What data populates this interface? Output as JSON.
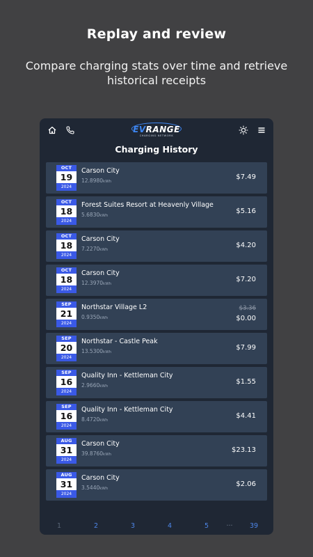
{
  "promo": {
    "title": "Replay and review",
    "subtitle": "Compare charging stats over time and retrieve historical receipts"
  },
  "app": {
    "logo": {
      "ev": "EV",
      "range": "RANGE",
      "tagline": "CHARGING NETWORK"
    },
    "title": "Charging History",
    "icons": [
      "home-icon",
      "phone-icon",
      "theme-sun-icon",
      "menu-icon"
    ],
    "colors": {
      "accent": "#3a59e6",
      "link": "#4d86e8",
      "card": "#324155",
      "background": "#1f2734"
    }
  },
  "sessions": [
    {
      "month": "OCT",
      "day": "19",
      "year": "2024",
      "site": "Carson City",
      "energy": "12.8980",
      "unit": "kWh",
      "price": "$7.49",
      "old_price": ""
    },
    {
      "month": "OCT",
      "day": "18",
      "year": "2024",
      "site": "Forest Suites Resort at Heavenly Village",
      "energy": "5.6830",
      "unit": "kWh",
      "price": "$5.16",
      "old_price": ""
    },
    {
      "month": "OCT",
      "day": "18",
      "year": "2024",
      "site": "Carson City",
      "energy": "7.2270",
      "unit": "kWh",
      "price": "$4.20",
      "old_price": ""
    },
    {
      "month": "OCT",
      "day": "18",
      "year": "2024",
      "site": "Carson City",
      "energy": "12.3970",
      "unit": "kWh",
      "price": "$7.20",
      "old_price": ""
    },
    {
      "month": "SEP",
      "day": "21",
      "year": "2024",
      "site": "Northstar Village L2",
      "energy": "0.9350",
      "unit": "kWh",
      "price": "$0.00",
      "old_price": "$3.36"
    },
    {
      "month": "SEP",
      "day": "20",
      "year": "2024",
      "site": "Northstar - Castle Peak",
      "energy": "13.5300",
      "unit": "kWh",
      "price": "$7.99",
      "old_price": ""
    },
    {
      "month": "SEP",
      "day": "16",
      "year": "2024",
      "site": "Quality Inn - Kettleman City",
      "energy": "2.9660",
      "unit": "kWh",
      "price": "$1.55",
      "old_price": ""
    },
    {
      "month": "SEP",
      "day": "16",
      "year": "2024",
      "site": "Quality Inn - Kettleman City",
      "energy": "8.4720",
      "unit": "kWh",
      "price": "$4.41",
      "old_price": ""
    },
    {
      "month": "AUG",
      "day": "31",
      "year": "2024",
      "site": "Carson City",
      "energy": "39.8760",
      "unit": "kWh",
      "price": "$23.13",
      "old_price": ""
    },
    {
      "month": "AUG",
      "day": "31",
      "year": "2024",
      "site": "Carson City",
      "energy": "3.5440",
      "unit": "kWh",
      "price": "$2.06",
      "old_price": ""
    }
  ],
  "pagination": {
    "current": "1",
    "pages": [
      "1",
      "2",
      "3",
      "4",
      "5"
    ],
    "ellipsis": "···",
    "last": "39"
  }
}
